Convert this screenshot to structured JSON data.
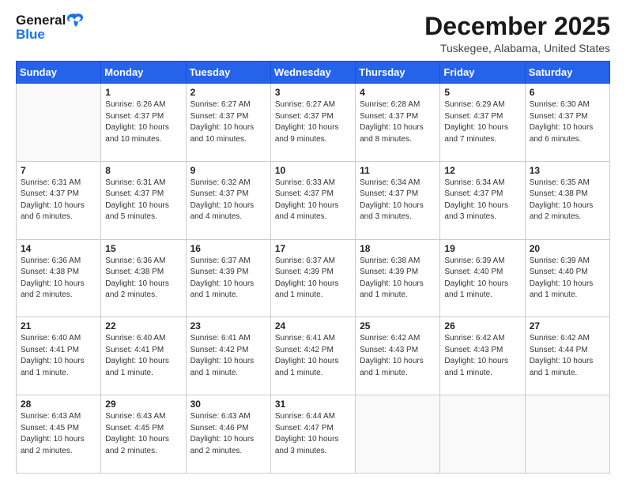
{
  "header": {
    "logo_general": "General",
    "logo_blue": "Blue",
    "month_title": "December 2025",
    "location": "Tuskegee, Alabama, United States"
  },
  "days_of_week": [
    "Sunday",
    "Monday",
    "Tuesday",
    "Wednesday",
    "Thursday",
    "Friday",
    "Saturday"
  ],
  "weeks": [
    [
      {
        "day": "",
        "info": ""
      },
      {
        "day": "1",
        "info": "Sunrise: 6:26 AM\nSunset: 4:37 PM\nDaylight: 10 hours\nand 10 minutes."
      },
      {
        "day": "2",
        "info": "Sunrise: 6:27 AM\nSunset: 4:37 PM\nDaylight: 10 hours\nand 10 minutes."
      },
      {
        "day": "3",
        "info": "Sunrise: 6:27 AM\nSunset: 4:37 PM\nDaylight: 10 hours\nand 9 minutes."
      },
      {
        "day": "4",
        "info": "Sunrise: 6:28 AM\nSunset: 4:37 PM\nDaylight: 10 hours\nand 8 minutes."
      },
      {
        "day": "5",
        "info": "Sunrise: 6:29 AM\nSunset: 4:37 PM\nDaylight: 10 hours\nand 7 minutes."
      },
      {
        "day": "6",
        "info": "Sunrise: 6:30 AM\nSunset: 4:37 PM\nDaylight: 10 hours\nand 6 minutes."
      }
    ],
    [
      {
        "day": "7",
        "info": "Sunrise: 6:31 AM\nSunset: 4:37 PM\nDaylight: 10 hours\nand 6 minutes."
      },
      {
        "day": "8",
        "info": "Sunrise: 6:31 AM\nSunset: 4:37 PM\nDaylight: 10 hours\nand 5 minutes."
      },
      {
        "day": "9",
        "info": "Sunrise: 6:32 AM\nSunset: 4:37 PM\nDaylight: 10 hours\nand 4 minutes."
      },
      {
        "day": "10",
        "info": "Sunrise: 6:33 AM\nSunset: 4:37 PM\nDaylight: 10 hours\nand 4 minutes."
      },
      {
        "day": "11",
        "info": "Sunrise: 6:34 AM\nSunset: 4:37 PM\nDaylight: 10 hours\nand 3 minutes."
      },
      {
        "day": "12",
        "info": "Sunrise: 6:34 AM\nSunset: 4:37 PM\nDaylight: 10 hours\nand 3 minutes."
      },
      {
        "day": "13",
        "info": "Sunrise: 6:35 AM\nSunset: 4:38 PM\nDaylight: 10 hours\nand 2 minutes."
      }
    ],
    [
      {
        "day": "14",
        "info": "Sunrise: 6:36 AM\nSunset: 4:38 PM\nDaylight: 10 hours\nand 2 minutes."
      },
      {
        "day": "15",
        "info": "Sunrise: 6:36 AM\nSunset: 4:38 PM\nDaylight: 10 hours\nand 2 minutes."
      },
      {
        "day": "16",
        "info": "Sunrise: 6:37 AM\nSunset: 4:39 PM\nDaylight: 10 hours\nand 1 minute."
      },
      {
        "day": "17",
        "info": "Sunrise: 6:37 AM\nSunset: 4:39 PM\nDaylight: 10 hours\nand 1 minute."
      },
      {
        "day": "18",
        "info": "Sunrise: 6:38 AM\nSunset: 4:39 PM\nDaylight: 10 hours\nand 1 minute."
      },
      {
        "day": "19",
        "info": "Sunrise: 6:39 AM\nSunset: 4:40 PM\nDaylight: 10 hours\nand 1 minute."
      },
      {
        "day": "20",
        "info": "Sunrise: 6:39 AM\nSunset: 4:40 PM\nDaylight: 10 hours\nand 1 minute."
      }
    ],
    [
      {
        "day": "21",
        "info": "Sunrise: 6:40 AM\nSunset: 4:41 PM\nDaylight: 10 hours\nand 1 minute."
      },
      {
        "day": "22",
        "info": "Sunrise: 6:40 AM\nSunset: 4:41 PM\nDaylight: 10 hours\nand 1 minute."
      },
      {
        "day": "23",
        "info": "Sunrise: 6:41 AM\nSunset: 4:42 PM\nDaylight: 10 hours\nand 1 minute."
      },
      {
        "day": "24",
        "info": "Sunrise: 6:41 AM\nSunset: 4:42 PM\nDaylight: 10 hours\nand 1 minute."
      },
      {
        "day": "25",
        "info": "Sunrise: 6:42 AM\nSunset: 4:43 PM\nDaylight: 10 hours\nand 1 minute."
      },
      {
        "day": "26",
        "info": "Sunrise: 6:42 AM\nSunset: 4:43 PM\nDaylight: 10 hours\nand 1 minute."
      },
      {
        "day": "27",
        "info": "Sunrise: 6:42 AM\nSunset: 4:44 PM\nDaylight: 10 hours\nand 1 minute."
      }
    ],
    [
      {
        "day": "28",
        "info": "Sunrise: 6:43 AM\nSunset: 4:45 PM\nDaylight: 10 hours\nand 2 minutes."
      },
      {
        "day": "29",
        "info": "Sunrise: 6:43 AM\nSunset: 4:45 PM\nDaylight: 10 hours\nand 2 minutes."
      },
      {
        "day": "30",
        "info": "Sunrise: 6:43 AM\nSunset: 4:46 PM\nDaylight: 10 hours\nand 2 minutes."
      },
      {
        "day": "31",
        "info": "Sunrise: 6:44 AM\nSunset: 4:47 PM\nDaylight: 10 hours\nand 3 minutes."
      },
      {
        "day": "",
        "info": ""
      },
      {
        "day": "",
        "info": ""
      },
      {
        "day": "",
        "info": ""
      }
    ]
  ]
}
